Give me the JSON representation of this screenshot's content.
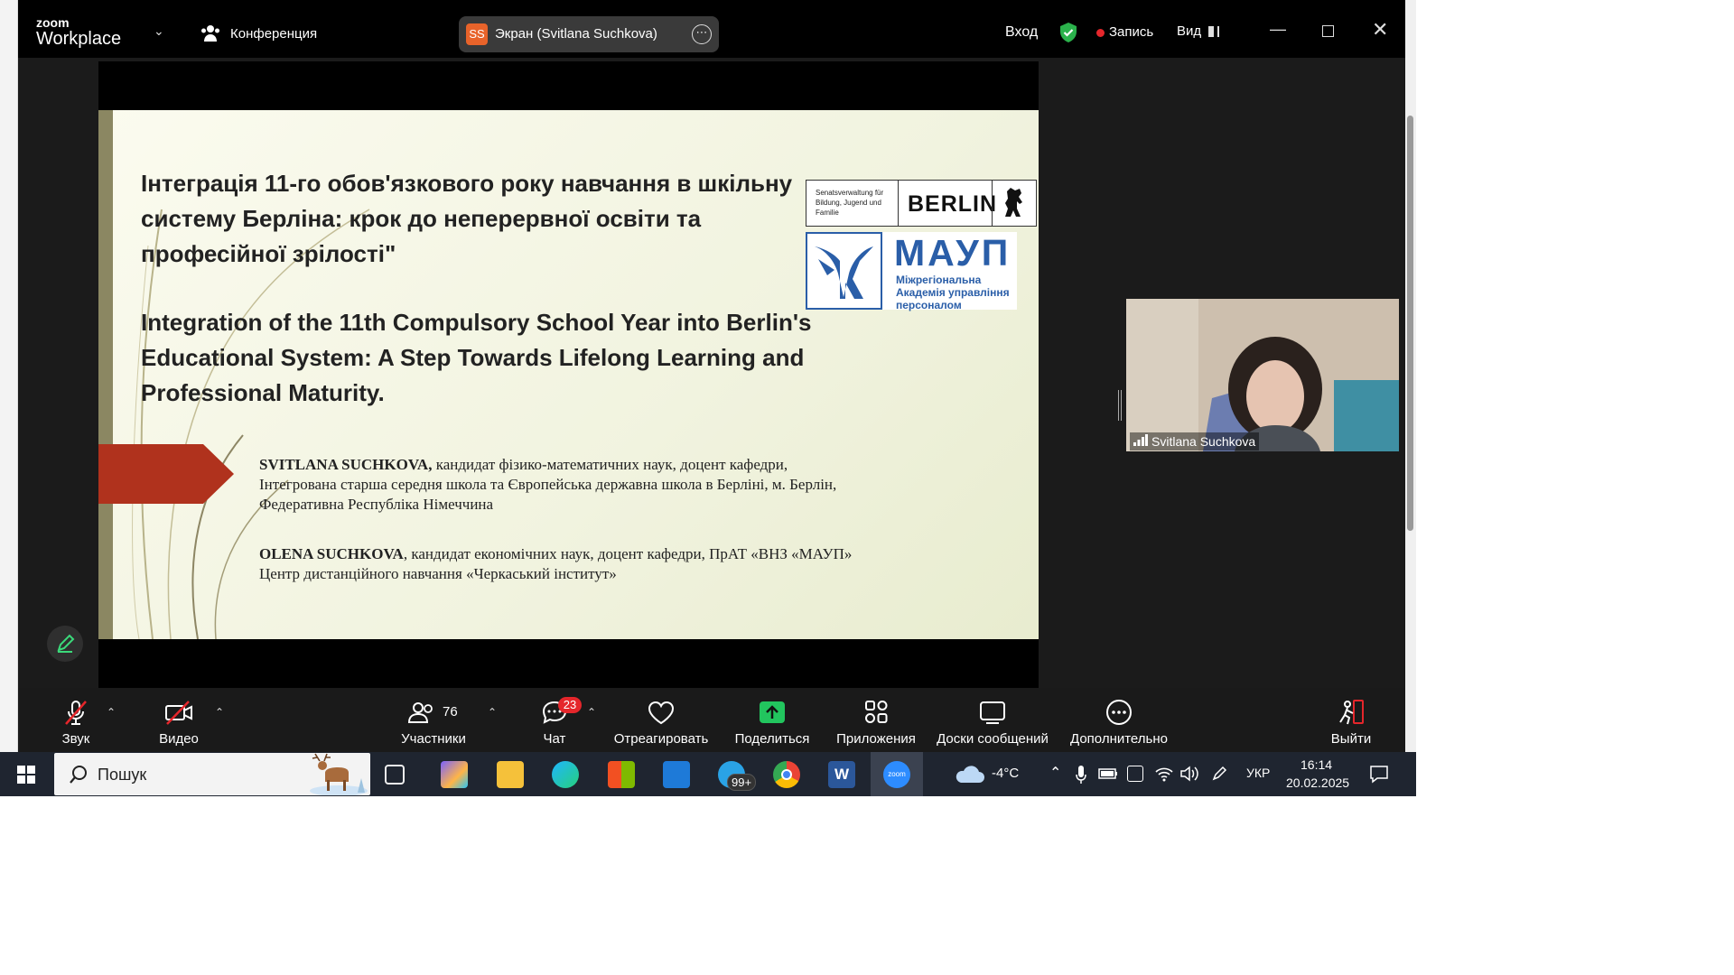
{
  "titlebar": {
    "logo_line1": "zoom",
    "logo_line2": "Workplace",
    "meeting_label": "Конференция",
    "share_badge": "SS",
    "share_label": "Экран (Svitlana Suchkova)",
    "login_label": "Вход",
    "record_label": "Запись",
    "view_label": "Вид"
  },
  "slide": {
    "title_ua": "Інтеграція 11-го обов'язкового року навчання в шкільну систему Берліна: крок до неперервної освіти та професійної зрілості\"",
    "title_en": "Integration of the 11th Compulsory School Year into Berlin's Educational System: A Step Towards Lifelong Learning and Professional Maturity.",
    "author1_name": "SVITLANA SUCHKOVA,",
    "author1_text": " кандидат фізико-математичних наук, доцент кафедри, Інтегрована старша середня школа та Європейська державна школа в Берліні, м. Берлін, Федеративна Республіка Німеччина",
    "author2_name": "OLENA SUCHKOVA",
    "author2_text": ", кандидат економічних наук, доцент кафедри, ПрАТ «ВНЗ «МАУП» Центр дистанційного навчання «Черкаський інститут»",
    "berlin_small": "Senatsverwaltung für Bildung, Jugend und Familie",
    "berlin_big": "BERLIN",
    "maup_title": "МАУП",
    "maup_sub": "Міжрегіональна Академія управління персоналом"
  },
  "video": {
    "participant_name": "Svitlana Suchkova"
  },
  "toolbar": {
    "audio": "Звук",
    "video": "Видео",
    "participants": "Участники",
    "participants_count": "76",
    "chat": "Чат",
    "chat_badge": "23",
    "react": "Отреагировать",
    "share": "Поделиться",
    "apps": "Приложения",
    "boards": "Доски сообщений",
    "more": "Дополнительно",
    "leave": "Выйти"
  },
  "taskbar": {
    "search_placeholder": "Пошук",
    "telegram_badge": "99+",
    "zoom_label": "zoom",
    "word_label": "W",
    "weather": "-4°C",
    "lang": "УКР",
    "time": "16:14",
    "date": "20.02.2025"
  }
}
